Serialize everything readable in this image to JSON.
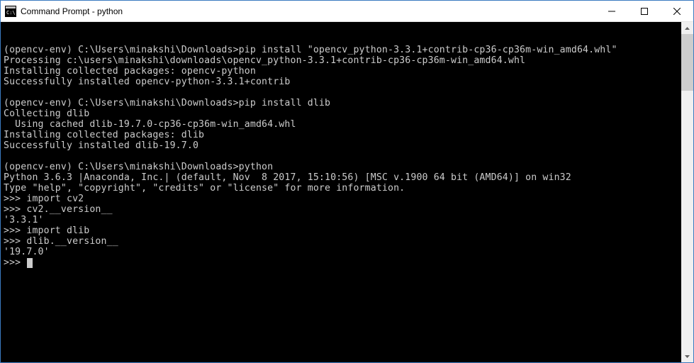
{
  "window": {
    "title": "Command Prompt - python"
  },
  "terminal": {
    "line1": "(opencv-env) C:\\Users\\minakshi\\Downloads>pip install \"opencv_python-3.3.1+contrib-cp36-cp36m-win_amd64.whl\"",
    "line2": "Processing c:\\users\\minakshi\\downloads\\opencv_python-3.3.1+contrib-cp36-cp36m-win_amd64.whl",
    "line3": "Installing collected packages: opencv-python",
    "line4": "Successfully installed opencv-python-3.3.1+contrib",
    "line5": "(opencv-env) C:\\Users\\minakshi\\Downloads>pip install dlib",
    "line6": "Collecting dlib",
    "line7": "  Using cached dlib-19.7.0-cp36-cp36m-win_amd64.whl",
    "line8": "Installing collected packages: dlib",
    "line9": "Successfully installed dlib-19.7.0",
    "line10": "(opencv-env) C:\\Users\\minakshi\\Downloads>python",
    "line11": "Python 3.6.3 |Anaconda, Inc.| (default, Nov  8 2017, 15:10:56) [MSC v.1900 64 bit (AMD64)] on win32",
    "line12": "Type \"help\", \"copyright\", \"credits\" or \"license\" for more information.",
    "line13": ">>> import cv2",
    "line14": ">>> cv2.__version__",
    "line15": "'3.3.1'",
    "line16": ">>> import dlib",
    "line17": ">>> dlib.__version__",
    "line18": "'19.7.0'",
    "line19": ">>> "
  }
}
